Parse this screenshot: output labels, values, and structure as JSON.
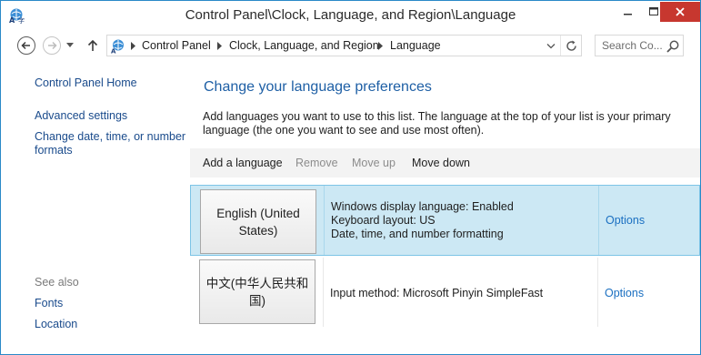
{
  "window": {
    "title": "Control Panel\\Clock, Language, and Region\\Language"
  },
  "address_bar": {
    "breadcrumbs": [
      "Control Panel",
      "Clock, Language, and Region",
      "Language"
    ]
  },
  "search": {
    "placeholder": "Search Co..."
  },
  "sidebar": {
    "links": [
      "Control Panel Home",
      "Advanced settings",
      "Change date, time, or number formats"
    ],
    "see_also_label": "See also",
    "see_also_links": [
      "Fonts",
      "Location"
    ]
  },
  "main": {
    "heading": "Change your language preferences",
    "description": "Add languages you want to use to this list. The language at the top of your list is your primary language (the one you want to see and use most often).",
    "toolbar": {
      "add": "Add a language",
      "remove": "Remove",
      "move_up": "Move up",
      "move_down": "Move down"
    },
    "languages": [
      {
        "name": "English (United States)",
        "details": [
          "Windows display language: Enabled",
          "Keyboard layout: US",
          "Date, time, and number formatting"
        ],
        "options_label": "Options",
        "selected": true
      },
      {
        "name": "中文(中华人民共和国)",
        "details": [
          "Input method: Microsoft Pinyin SimpleFast"
        ],
        "options_label": "Options",
        "selected": false
      }
    ]
  },
  "colors": {
    "selected_row": "#cce8f4",
    "link": "#1a4b8c",
    "heading": "#1e5fa5",
    "close_button": "#c7372f"
  }
}
